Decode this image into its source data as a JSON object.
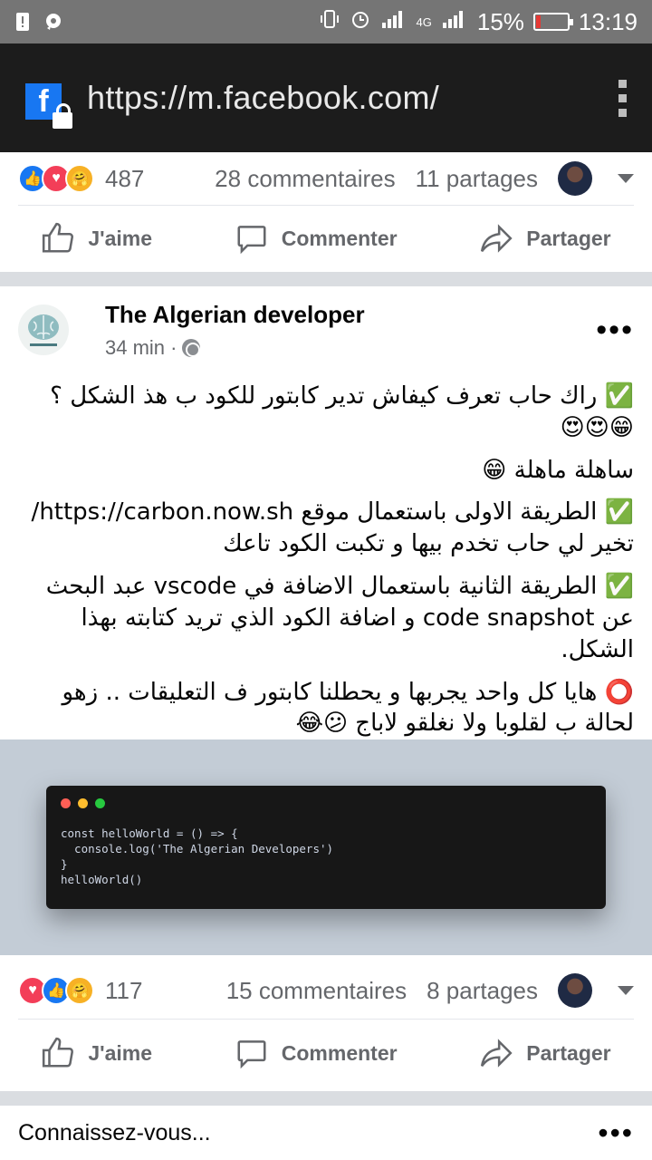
{
  "status_bar": {
    "battery_percent": "15%",
    "time": "13:19",
    "network_label": "4G",
    "battery_level": 0.15
  },
  "browser": {
    "url": "https://m.facebook.com/",
    "favicon_letter": "f"
  },
  "top_post": {
    "reactions_count": "487",
    "comments": "28 commentaires",
    "shares": "11 partages"
  },
  "actions": {
    "like": "J'aime",
    "comment": "Commenter",
    "share": "Partager"
  },
  "post": {
    "page_name": "The Algerian developer",
    "time": "34 min ·",
    "paragraphs": [
      "✅ راك حاب تعرف كيفاش تدير كابتور للكود ب هذ الشكل ؟ 😁😍😍",
      "ساهلة ماهلة 😁",
      "✅ الطريقة الاولى باستعمال موقع https://carbon.now.sh/ تخير لي حاب تخدم بيها و تكبت الكود تاعك",
      "✅ الطريقة الثانية باستعمال الاضافة في vscode عبد البحث عن code snapshot و اضافة الكود الذي تريد كتابته بهذا الشكل.",
      "⭕ هايا كل واحد يجربها و يحطلنا كابتور ف التعليقات .. زهو لحالة ب لقلوبا ولا نغلقو لاباج 😕😂"
    ],
    "code_lines": [
      "const helloWorld = () => {",
      "  console.log('The Algerian Developers')",
      "}",
      "helloWorld()"
    ],
    "reactions_count": "117",
    "comments": "15 commentaires",
    "shares": "8 partages"
  },
  "suggestion": {
    "title": "Connaissez-vous..."
  }
}
